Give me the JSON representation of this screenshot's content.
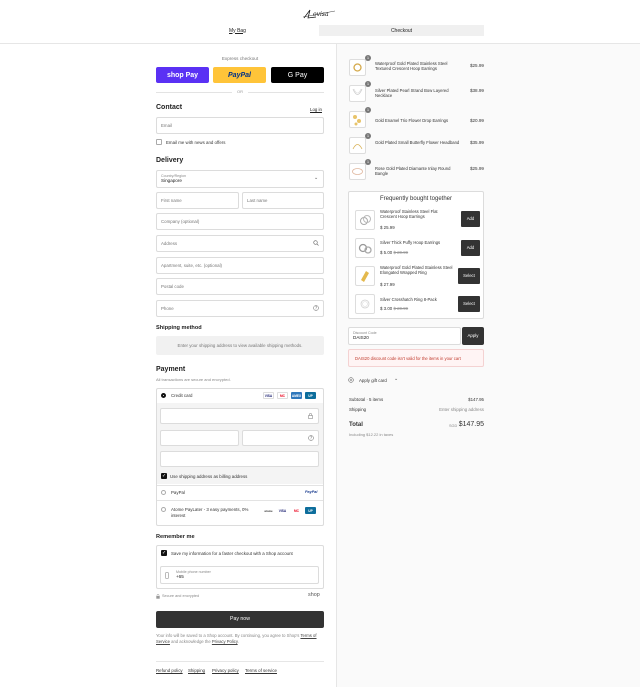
{
  "header": {
    "logo_text": "Lovisa",
    "steps": [
      "My Bag",
      "Checkout"
    ]
  },
  "express": {
    "title": "Express checkout",
    "buttons": [
      "shop Pay",
      "PayPal",
      "G Pay"
    ],
    "or": "OR"
  },
  "contact": {
    "heading": "Contact",
    "login": "Log in",
    "email_placeholder": "Email",
    "news_label": "Email me with news and offers"
  },
  "delivery": {
    "heading": "Delivery",
    "country_label": "Country/Region",
    "country_value": "Singapore",
    "first_name": "First name",
    "last_name": "Last name",
    "company": "Company (optional)",
    "address": "Address",
    "apartment": "Apartment, suite, etc. (optional)",
    "postal": "Postal code",
    "phone": "Phone"
  },
  "shipping": {
    "heading": "Shipping method",
    "message": "Enter your shipping address to view available shipping methods."
  },
  "payment": {
    "heading": "Payment",
    "subtitle": "All transactions are secure and encrypted.",
    "credit_card": "Credit card",
    "card_logos": [
      "VISA",
      "MC",
      "AMEX",
      "UP"
    ],
    "billing_label": "Use shipping address as billing address",
    "paypal": "PayPal",
    "paypal_logo": "PayPal",
    "atome": "Atome PayLater - 3 easy payments, 0% interest",
    "atome_logos": [
      "atome",
      "VISA",
      "MC",
      "UP"
    ]
  },
  "remember": {
    "heading": "Remember me",
    "save_label": "Save my information for a faster checkout with a Shop account",
    "mobile_label": "Mobile phone number",
    "mobile_value": "+65",
    "secure": "Secure and encrypted",
    "shop": "shop"
  },
  "pay_now": "Pay now",
  "legal": {
    "line1": "Your info will be saved to a Shop account. By continuing, you agree to Shop's",
    "terms": "Terms of Service",
    "and": " and acknowledge the ",
    "privacy": "Privacy Policy",
    "end": "."
  },
  "footer_links": [
    "Refund policy",
    "Shipping",
    "Privacy policy",
    "Terms of service"
  ],
  "cart": {
    "items": [
      {
        "qty": "1",
        "name": "Waterproof Gold Plated Stainless Steel Textured Crescent Hoop Earrings",
        "price": "$25.99"
      },
      {
        "qty": "1",
        "name": "Silver Plated Pearl Strand Bow Layered Necklace",
        "price": "$38.99"
      },
      {
        "qty": "1",
        "name": "Gold Enamel Trio Flower Drop Earrings",
        "price": "$20.99"
      },
      {
        "qty": "1",
        "name": "Gold Plated Small Butterfly Flower Headband",
        "price": "$35.99"
      },
      {
        "qty": "1",
        "name": "Rose Gold Plated Diamante Inlay Round Bangle",
        "price": "$25.99"
      }
    ]
  },
  "fbt": {
    "heading": "Frequently bought together",
    "items": [
      {
        "name": "Waterproof Stainless Steel Flat Crescent Hoop Earrings",
        "price": "$ 25.99",
        "old_price": "",
        "button": "Add"
      },
      {
        "name": "Silver Thick Puffy Hoop Earrings",
        "price": "$ 5.00",
        "old_price": "$ 20.99",
        "button": "Add"
      },
      {
        "name": "Waterproof Gold Plated Stainless Steel Elongated Wrapped Ring",
        "price": "$ 27.99",
        "old_price": "",
        "button": "Select"
      },
      {
        "name": "Silver Crosshatch Ring 8-Pack",
        "price": "$ 3.00",
        "old_price": "$ 20.99",
        "button": "Select"
      }
    ]
  },
  "discount": {
    "label": "Discount Code",
    "value": "DAIS20",
    "apply": "Apply",
    "error": "DAIS20 discount code isn't valid for the items in your cart"
  },
  "gift": {
    "label": "Apply gift card"
  },
  "summary": {
    "subtotal_label": "Subtotal · 5 items",
    "subtotal_value": "$147.95",
    "shipping_label": "Shipping",
    "shipping_value": "Enter shipping address",
    "total_label": "Total",
    "currency": "SGD",
    "total_value": "$147.95",
    "tax_note": "Including $12.22 in taxes"
  }
}
